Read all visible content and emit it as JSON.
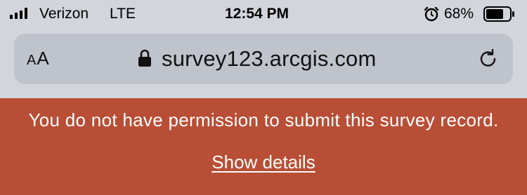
{
  "status_bar": {
    "carrier": "Verizon",
    "network": "LTE",
    "time": "12:54 PM",
    "battery_percent": "68%",
    "icons": [
      "signal-icon",
      "alarm-icon",
      "battery-icon"
    ]
  },
  "browser": {
    "text_size_label_small": "A",
    "text_size_label_large": "A",
    "url": "survey123.arcgis.com",
    "icons": [
      "lock-icon",
      "reload-icon"
    ]
  },
  "error_banner": {
    "message": "You do not have permission to submit this survey record.",
    "link_label": "Show details",
    "background_color": "#b84e35"
  }
}
